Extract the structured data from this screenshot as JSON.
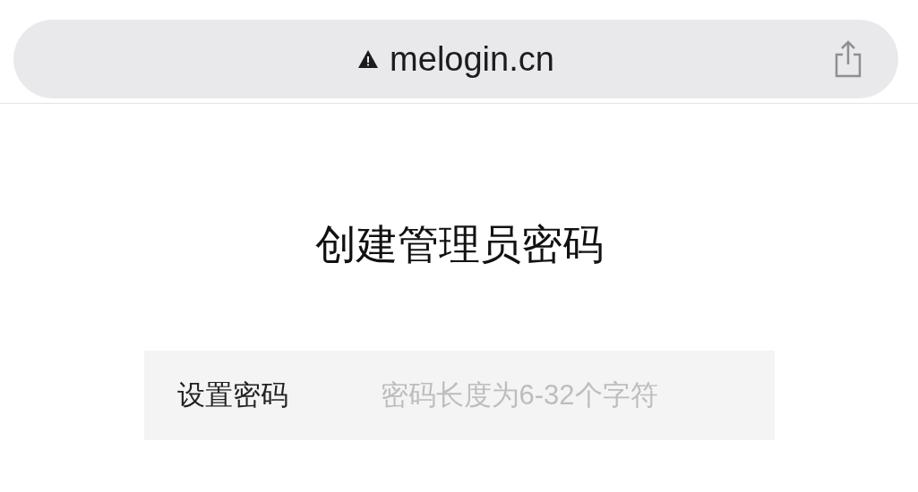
{
  "address_bar": {
    "url": "melogin.cn",
    "insecure": true
  },
  "page": {
    "title": "创建管理员密码",
    "fields": [
      {
        "label": "设置密码",
        "placeholder": "密码长度为6-32个字符"
      }
    ]
  }
}
